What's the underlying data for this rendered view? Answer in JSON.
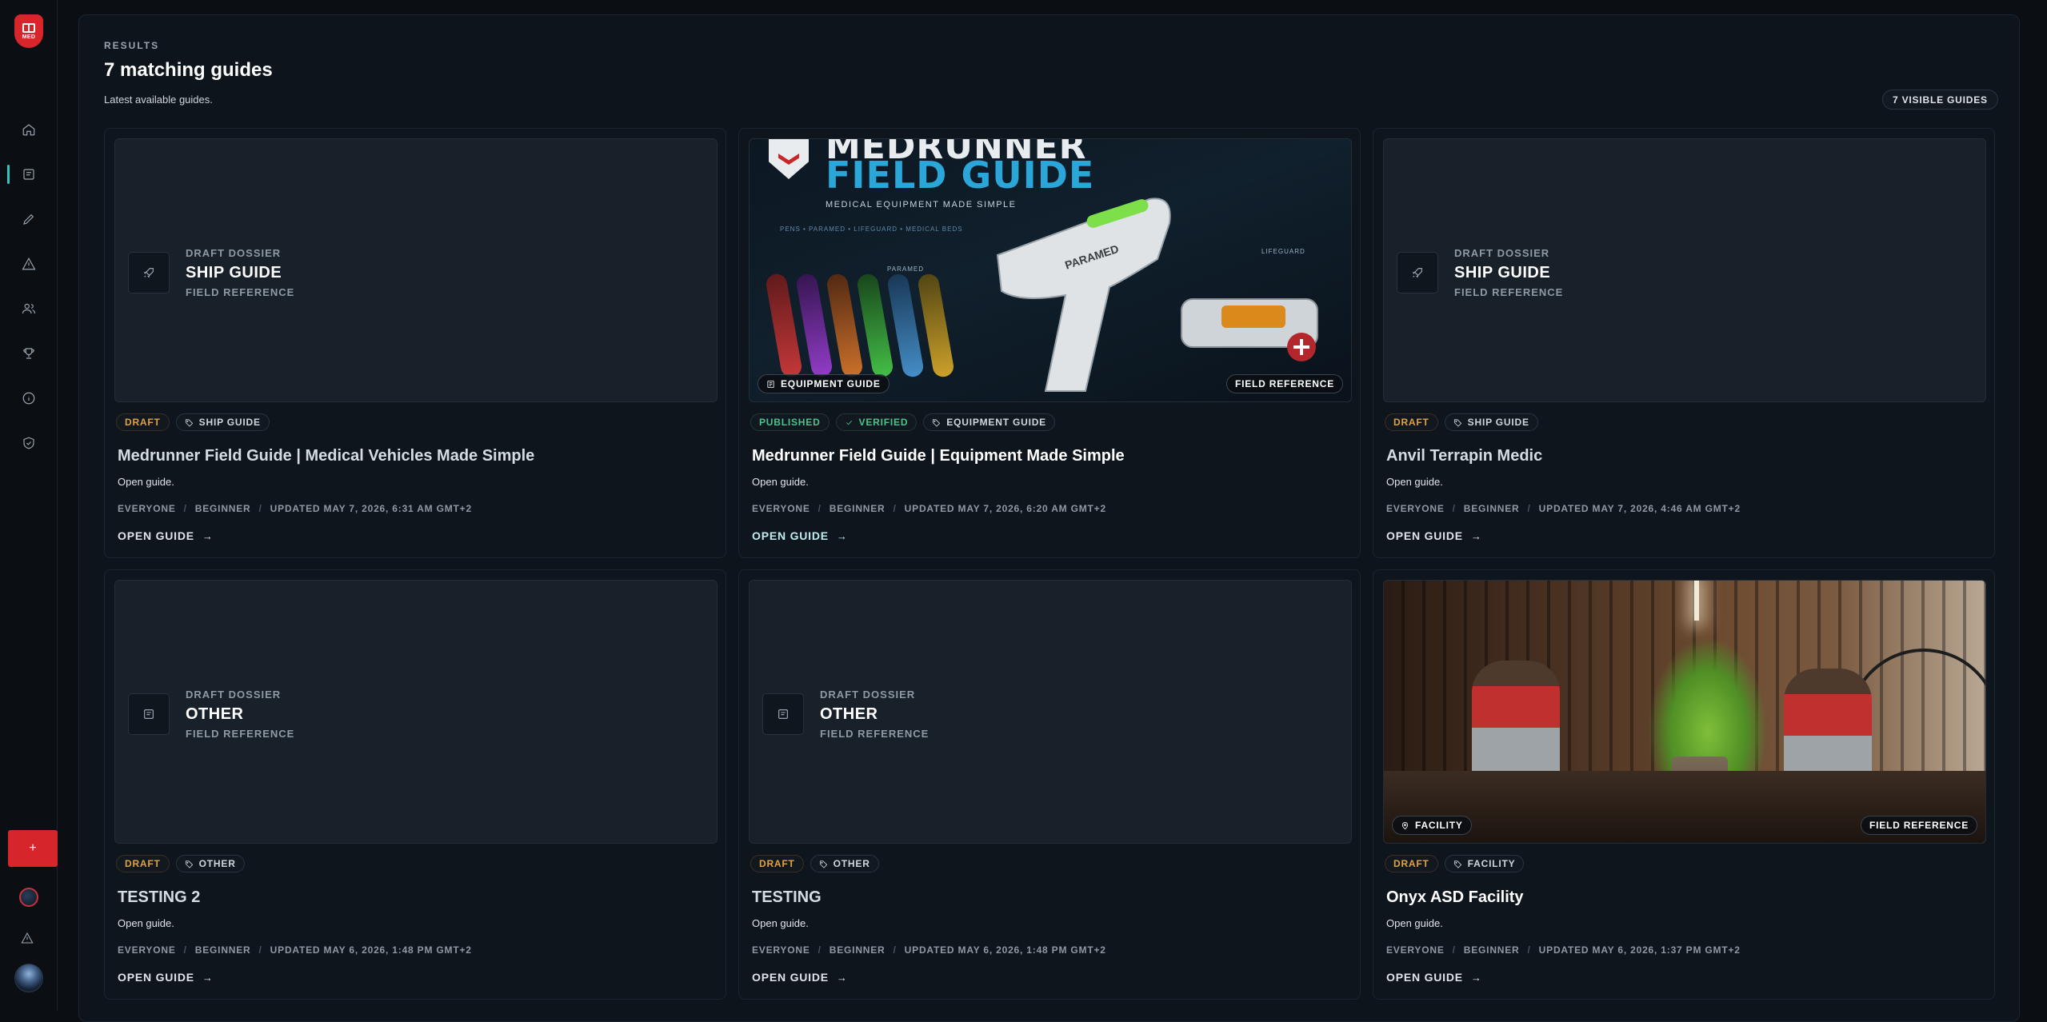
{
  "sidebar": {
    "logo_text": "MED",
    "nav": [
      "home-icon",
      "guides-icon",
      "edit-icon",
      "alert-icon",
      "users-icon",
      "trophy-icon",
      "info-icon",
      "shield-check-icon"
    ],
    "add_label": "+"
  },
  "header": {
    "eyebrow": "RESULTS",
    "title": "7 matching guides",
    "subtitle": "Latest available guides.",
    "visible_badge": "7 VISIBLE GUIDES"
  },
  "colors": {
    "accent": "#2fc5c5",
    "brand": "#d7262b",
    "draft": "#e2a13f",
    "published": "#4cc38a"
  },
  "cards": [
    {
      "dossier": {
        "l1": "DRAFT DOSSIER",
        "l2": "SHIP GUIDE",
        "l3": "FIELD REFERENCE",
        "icon": "rocket-icon"
      },
      "tags": [
        {
          "label": "DRAFT"
        },
        {
          "label": "SHIP GUIDE"
        }
      ],
      "title": "Medrunner Field Guide | Medical Vehicles Made Simple",
      "desc": "Open guide.",
      "meta": [
        "EVERYONE",
        "BEGINNER",
        "UPDATED MAY 7, 2026, 6:31 AM GMT+2"
      ],
      "open": "OPEN GUIDE"
    },
    {
      "image": {
        "t1": "MEDRUNNER",
        "t2": "FIELD GUIDE",
        "t3": "MEDICAL EQUIPMENT MADE SIMPLE",
        "t4": "PENS  •  PARAMED  •  LIFEGUARD  •  MEDICAL BEDS",
        "gun_label": "PARAMED",
        "lbl_paramed": "PARAMED",
        "lbl_lifeguard": "LIFEGUARD"
      },
      "chip_left": "EQUIPMENT GUIDE",
      "chip_right": "FIELD REFERENCE",
      "tags": [
        {
          "label": "PUBLISHED"
        },
        {
          "label": "VERIFIED"
        },
        {
          "label": "EQUIPMENT GUIDE"
        }
      ],
      "title": "Medrunner Field Guide | Equipment Made Simple",
      "desc": "Open guide.",
      "meta": [
        "EVERYONE",
        "BEGINNER",
        "UPDATED MAY 7, 2026, 6:20 AM GMT+2"
      ],
      "open": "OPEN GUIDE"
    },
    {
      "dossier": {
        "l1": "DRAFT DOSSIER",
        "l2": "SHIP GUIDE",
        "l3": "FIELD REFERENCE",
        "icon": "rocket-icon"
      },
      "tags": [
        {
          "label": "DRAFT"
        },
        {
          "label": "SHIP GUIDE"
        }
      ],
      "title": "Anvil Terrapin Medic",
      "desc": "Open guide.",
      "meta": [
        "EVERYONE",
        "BEGINNER",
        "UPDATED MAY 7, 2026, 4:46 AM GMT+2"
      ],
      "open": "OPEN GUIDE"
    },
    {
      "dossier": {
        "l1": "DRAFT DOSSIER",
        "l2": "OTHER",
        "l3": "FIELD REFERENCE",
        "icon": "document-icon"
      },
      "tags": [
        {
          "label": "DRAFT"
        },
        {
          "label": "OTHER"
        }
      ],
      "title": "TESTING 2",
      "desc": "Open guide.",
      "meta": [
        "EVERYONE",
        "BEGINNER",
        "UPDATED MAY 6, 2026, 1:48 PM GMT+2"
      ],
      "open": "OPEN GUIDE"
    },
    {
      "dossier": {
        "l1": "DRAFT DOSSIER",
        "l2": "OTHER",
        "l3": "FIELD REFERENCE",
        "icon": "document-icon"
      },
      "tags": [
        {
          "label": "DRAFT"
        },
        {
          "label": "OTHER"
        }
      ],
      "title": "TESTING",
      "desc": "Open guide.",
      "meta": [
        "EVERYONE",
        "BEGINNER",
        "UPDATED MAY 6, 2026, 1:48 PM GMT+2"
      ],
      "open": "OPEN GUIDE"
    },
    {
      "chip_left": "FACILITY",
      "chip_right": "FIELD REFERENCE",
      "tags": [
        {
          "label": "DRAFT"
        },
        {
          "label": "FACILITY"
        }
      ],
      "title": "Onyx ASD Facility",
      "desc": "Open guide.",
      "meta": [
        "EVERYONE",
        "BEGINNER",
        "UPDATED MAY 6, 2026, 1:37 PM GMT+2"
      ],
      "open": "OPEN GUIDE"
    }
  ]
}
